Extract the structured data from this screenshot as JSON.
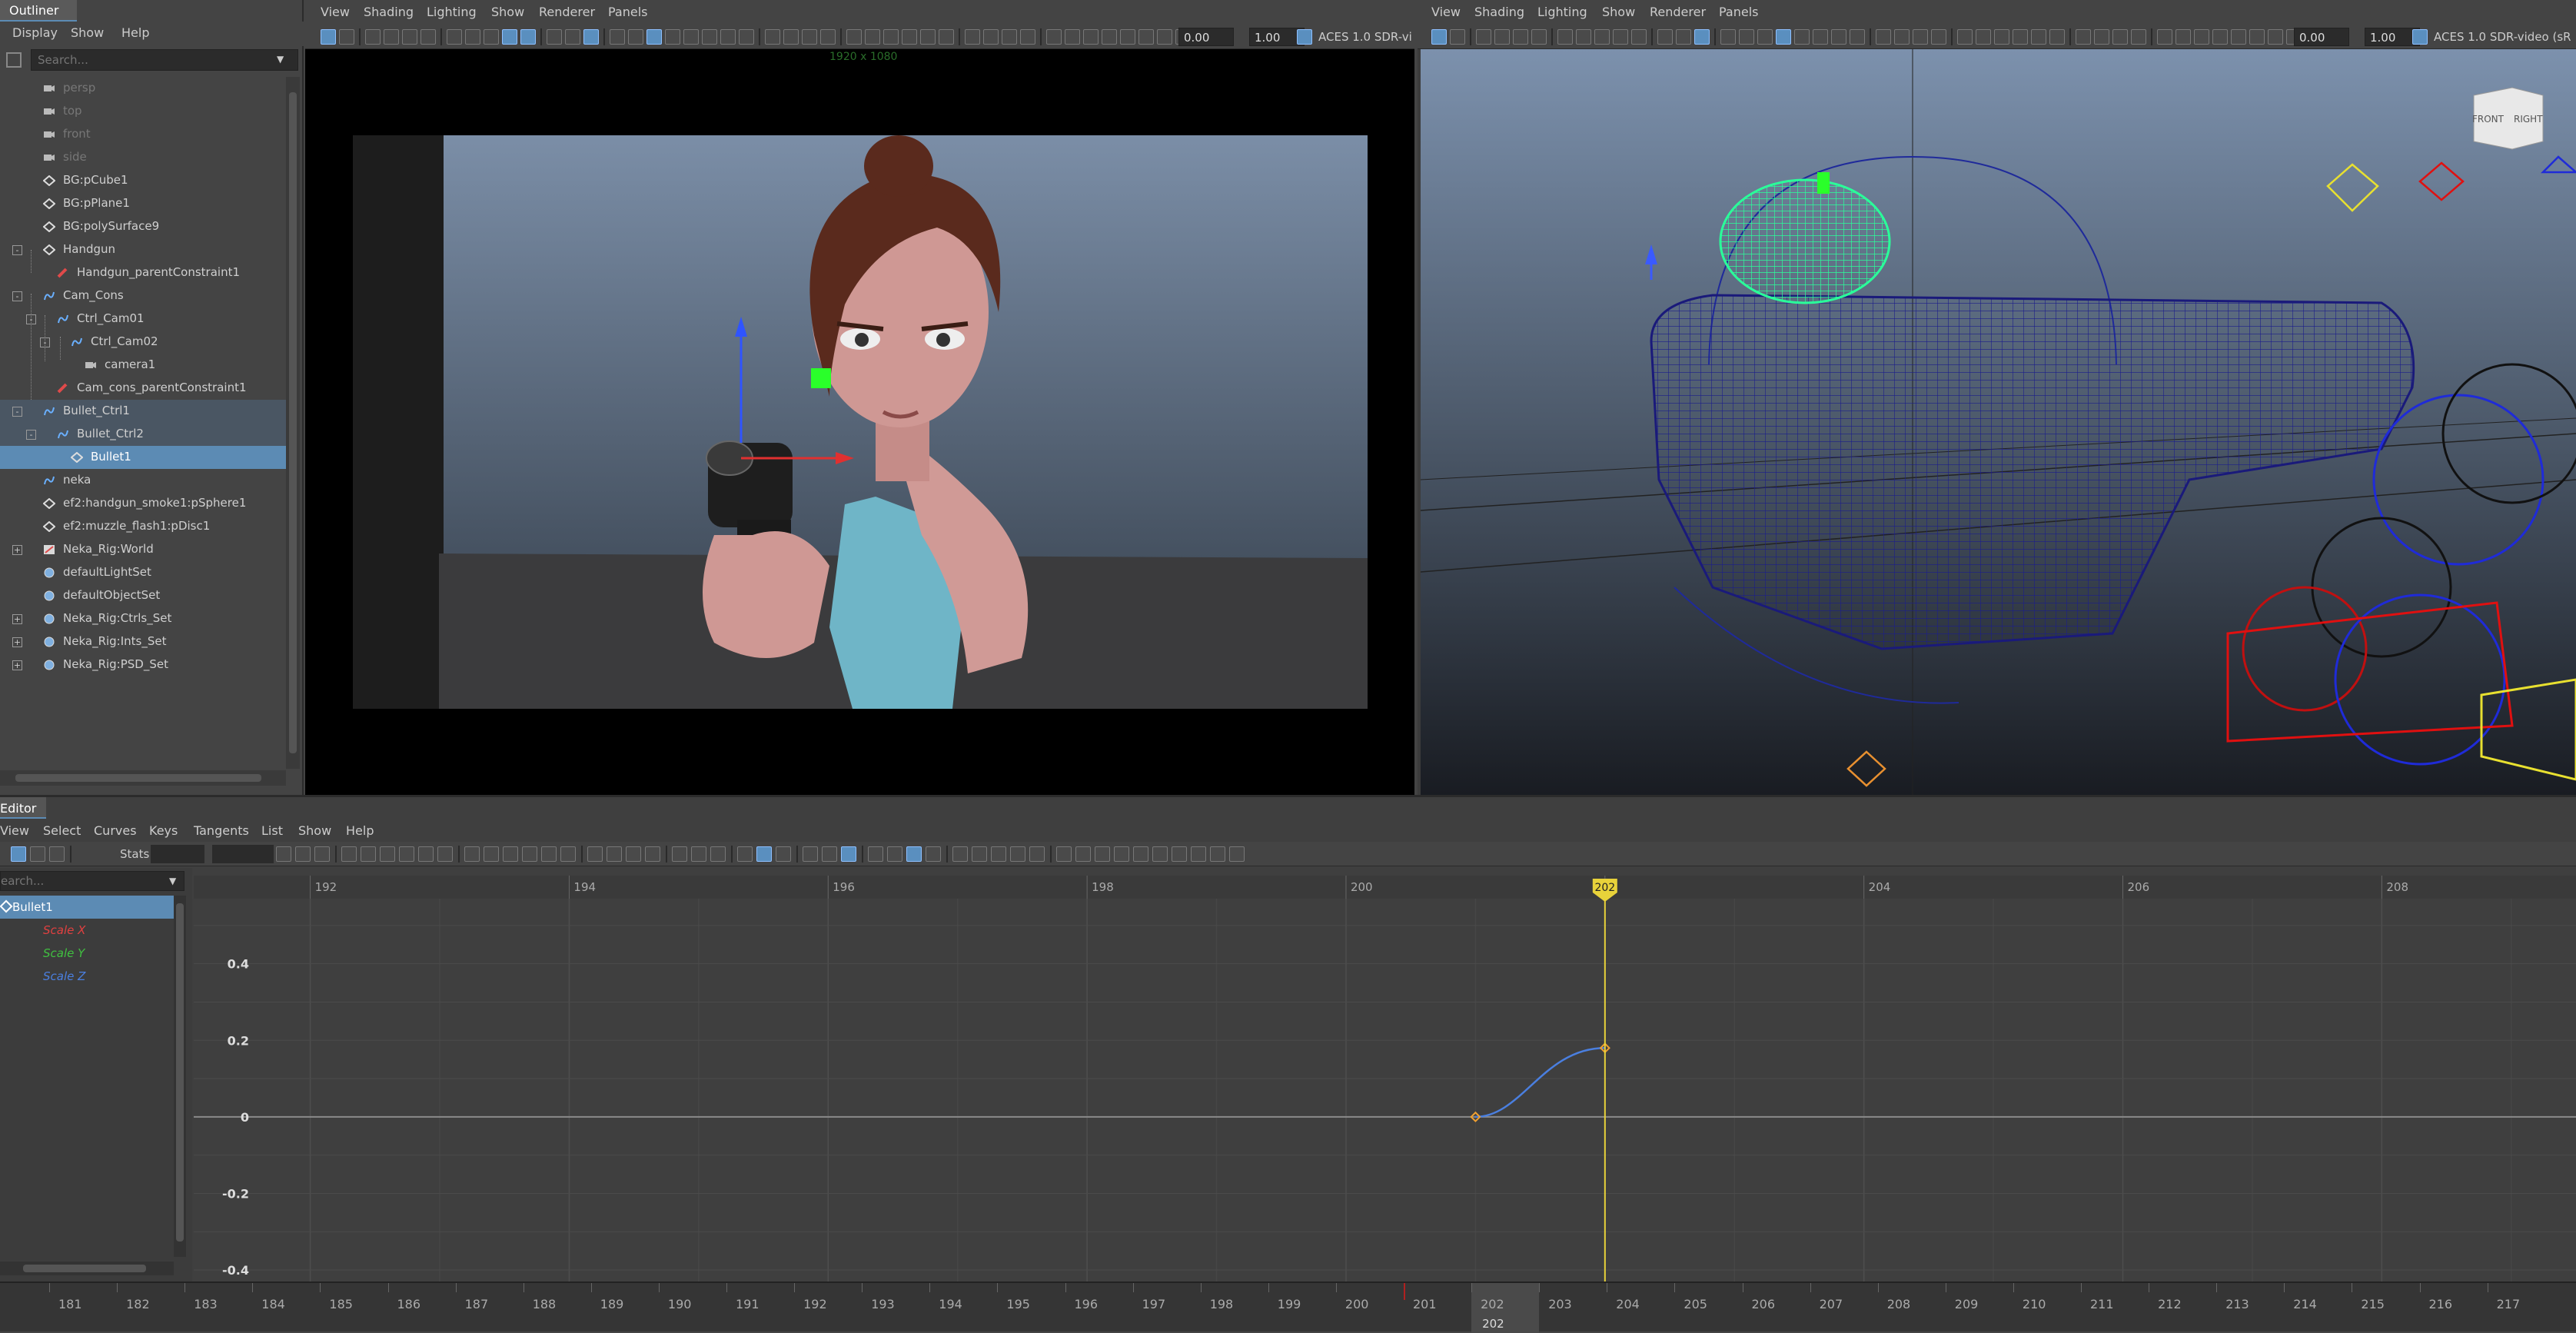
{
  "outliner": {
    "title": "Outliner",
    "menu": [
      "Display",
      "Show",
      "Help"
    ],
    "search_placeholder": "Search...",
    "items": [
      {
        "label": "persp",
        "type": "camera",
        "dim": true
      },
      {
        "label": "top",
        "type": "camera",
        "dim": true
      },
      {
        "label": "front",
        "type": "camera",
        "dim": true
      },
      {
        "label": "side",
        "type": "camera",
        "dim": true
      },
      {
        "label": "BG:pCube1",
        "type": "mesh"
      },
      {
        "label": "BG:pPlane1",
        "type": "mesh"
      },
      {
        "label": "BG:polySurface9",
        "type": "mesh"
      },
      {
        "label": "Handgun",
        "type": "mesh"
      },
      {
        "label": "Handgun_parentConstraint1",
        "type": "constraint"
      },
      {
        "label": "Cam_Cons",
        "type": "curve"
      },
      {
        "label": "Ctrl_Cam01",
        "type": "curve"
      },
      {
        "label": "Ctrl_Cam02",
        "type": "curve"
      },
      {
        "label": "camera1",
        "type": "camera"
      },
      {
        "label": "Cam_cons_parentConstraint1",
        "type": "constraint"
      },
      {
        "label": "Bullet_Ctrl1",
        "type": "curve"
      },
      {
        "label": "Bullet_Ctrl2",
        "type": "curve"
      },
      {
        "label": "Bullet1",
        "type": "mesh"
      },
      {
        "label": "neka",
        "type": "curve"
      },
      {
        "label": "ef2:handgun_smoke1:pSphere1",
        "type": "mesh"
      },
      {
        "label": "ef2:muzzle_flash1:pDisc1",
        "type": "mesh"
      },
      {
        "label": "Neka_Rig:World",
        "type": "rig"
      },
      {
        "label": "defaultLightSet",
        "type": "set"
      },
      {
        "label": "defaultObjectSet",
        "type": "set"
      },
      {
        "label": "Neka_Rig:Ctrls_Set",
        "type": "set"
      },
      {
        "label": "Neka_Rig:Ints_Set",
        "type": "set"
      },
      {
        "label": "Neka_Rig:PSD_Set",
        "type": "set"
      }
    ]
  },
  "viewport_left": {
    "menu": [
      "View",
      "Shading",
      "Lighting",
      "Show",
      "Renderer",
      "Panels"
    ],
    "field_a": "0.00",
    "field_b": "1.00",
    "color_space": "ACES 1.0 SDR-vi",
    "resolution": "1920 x 1080"
  },
  "viewport_right": {
    "menu": [
      "View",
      "Shading",
      "Lighting",
      "Show",
      "Renderer",
      "Panels"
    ],
    "field_a": "0.00",
    "field_b": "1.00",
    "color_space": "ACES 1.0 SDR-video (sR",
    "viewcube_front": "FRONT",
    "viewcube_right": "RIGHT"
  },
  "graph_editor": {
    "title": "Editor",
    "menu": [
      "View",
      "Select",
      "Curves",
      "Keys",
      "Tangents",
      "List",
      "Show",
      "Help"
    ],
    "stats_label": "Stats",
    "search_placeholder": "earch...",
    "node": "Bullet1",
    "channels": [
      {
        "label": "Scale X",
        "color": "#e04040"
      },
      {
        "label": "Scale Y",
        "color": "#40c040"
      },
      {
        "label": "Scale Z",
        "color": "#4a7fe0"
      }
    ],
    "frame_ticks": [
      "192",
      "194",
      "196",
      "198",
      "200",
      "2",
      "204",
      "206",
      "208"
    ],
    "value_ticks": [
      "0.4",
      "0.2",
      "0",
      "-0.2",
      "-0.4"
    ],
    "current_frame": "202"
  },
  "chart_data": {
    "type": "line",
    "series": [
      {
        "name": "Scale Z",
        "points": [
          [
            201,
            0.0
          ],
          [
            202,
            0.18
          ]
        ]
      }
    ],
    "xlim": [
      191.1,
      209.5
    ],
    "ylim": [
      -0.43,
      0.57
    ]
  },
  "timeline": {
    "frames": [
      "181",
      "182",
      "183",
      "184",
      "185",
      "186",
      "187",
      "188",
      "189",
      "190",
      "191",
      "192",
      "193",
      "194",
      "195",
      "196",
      "197",
      "198",
      "199",
      "200",
      "201",
      "202",
      "203",
      "204",
      "205",
      "206",
      "207",
      "208",
      "209",
      "210",
      "211",
      "212",
      "213",
      "214",
      "215",
      "216",
      "217"
    ],
    "current": "202",
    "current_under": "202"
  },
  "colors": {
    "selection": "#5c8bb4",
    "playhead": "#e8d23a",
    "curve_blue": "#4a7fe0",
    "key_orange": "#f0a030"
  }
}
